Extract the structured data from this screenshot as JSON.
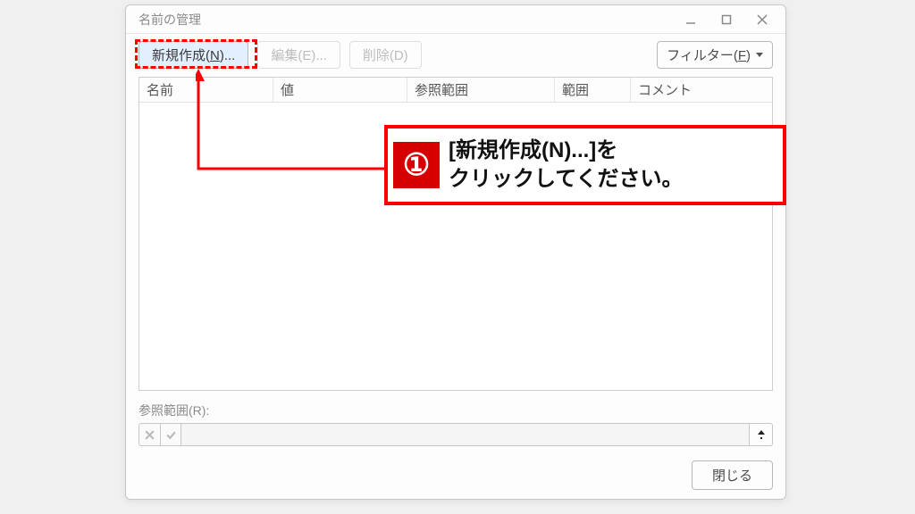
{
  "dialog": {
    "title": "名前の管理"
  },
  "toolbar": {
    "new_label": "新規作成(N)...",
    "edit_label": "編集(E)...",
    "delete_label": "削除(D)",
    "filter_label": "フィルター(F)"
  },
  "columns": {
    "name": "名前",
    "value": "値",
    "refers": "参照範囲",
    "scope": "範囲",
    "comment": "コメント"
  },
  "reference": {
    "label": "参照範囲(R):",
    "value": ""
  },
  "footer": {
    "close": "閉じる"
  },
  "callout": {
    "step": "①",
    "line1": "[新規作成(N)...]を",
    "line2": "クリックしてください。"
  }
}
